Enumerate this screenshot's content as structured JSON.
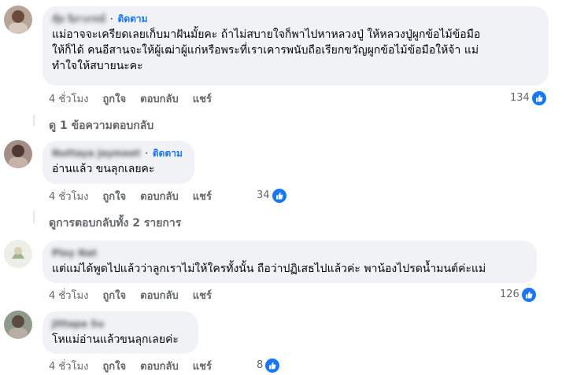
{
  "comments": [
    {
      "name": "nุ้ย นิภาภรณ์",
      "follow": "ติดตาม",
      "text": [
        "แม่อาจจะเครียดเลยเก็บมาฝันมั้ยคะ ถ้าไม่สบายใจก็พาไปหาหลวงปู่ ให้หลวงปู่ผูกข้อไม้ข้อมือ",
        "ให้ก็ได้ คนอีสานจะให้ผู้เฒ่าผู้แก่หรือพระที่เราเคารพนับถือเรียกขวัญผูกข้อไม้ข้อมือให้จ้า แม่",
        "ทำใจให้สบายนะคะ"
      ],
      "time": "4 ชั่วโมง",
      "like": "ถูกใจ",
      "reply": "ตอบกลับ",
      "share": "แชร์",
      "reactions": "134",
      "replies_link": "ดู 1 ข้อความตอบกลับ"
    },
    {
      "name": "Nuttaya Jaymeet",
      "follow": "ติดตาม",
      "text": [
        "อ่านแล้ว ขนลุกเลยคะ"
      ],
      "time": "4 ชั่วโมง",
      "like": "ถูกใจ",
      "reply": "ตอบกลับ",
      "share": "แชร์",
      "reactions": "34",
      "replies_link": "ดูการตอบกลับทั้ง 2 รายการ"
    },
    {
      "name": "Ploy Nat",
      "text": [
        "แต่แม่ได้พูดไปแล้วว่าลูกเราไม่ให้ใครทั้งนั้น ถือว่าปฏิเสธไปแล้วค่ะ พาน้องไปรดน้ำมนต์ค่ะแม่"
      ],
      "time": "4 ชั่วโมง",
      "like": "ถูกใจ",
      "reply": "ตอบกลับ",
      "share": "แชร์",
      "reactions": "126"
    },
    {
      "name": "Jittapa Su",
      "text": [
        "โหแม่อ่านแล้วขนลุกเลยค่ะ"
      ],
      "time": "4 ชั่วโมง",
      "like": "ถูกใจ",
      "reply": "ตอบกลับ",
      "share": "แชร์",
      "reactions": "8"
    }
  ],
  "colors": {
    "bubble": "#f0f2f5",
    "link": "#1877f2",
    "meta": "#65676b"
  },
  "icons": {
    "like": "thumbs-up-icon",
    "reply_arrow": "reply-arrow-icon"
  }
}
